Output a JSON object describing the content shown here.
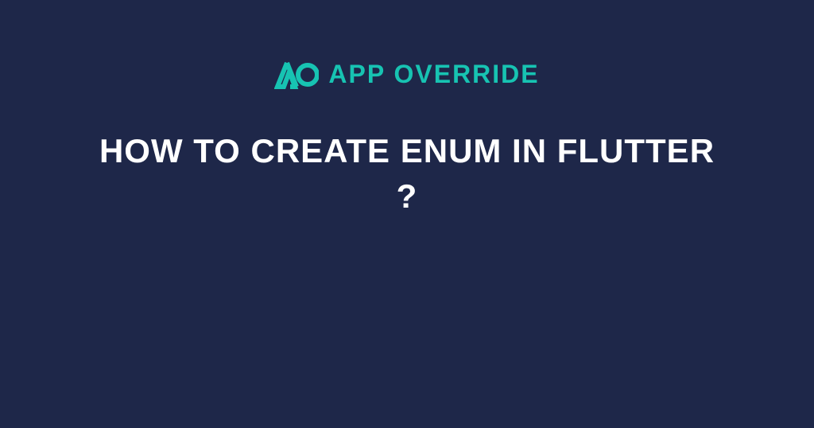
{
  "brand": {
    "name": "APP OVERRIDE",
    "accentColor": "#17C3B2"
  },
  "headline": "HOW TO CREATE ENUM IN FLUTTER ?",
  "colors": {
    "background": "#1e2749",
    "text": "#ffffff",
    "accent": "#17C3B2"
  }
}
